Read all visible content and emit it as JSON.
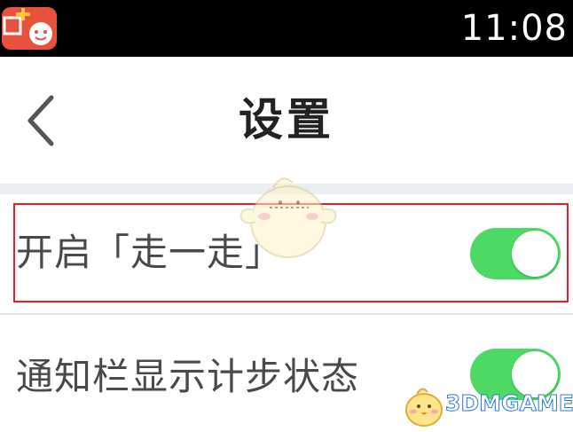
{
  "status_bar": {
    "time": "11:08",
    "notification_icon": "app-notification-icon"
  },
  "header": {
    "title": "设置",
    "back_icon": "chevron-left-icon"
  },
  "settings": [
    {
      "label": "开启「走一走」",
      "enabled": true
    },
    {
      "label": "通知栏显示计步状态",
      "enabled": true
    }
  ],
  "watermark": {
    "brand": "3DMGAME",
    "mascot_icon": "mascot-icon"
  },
  "colors": {
    "toggle_on": "#4cd964",
    "highlight": "#e0232b",
    "section_gap": "#e8eef1"
  }
}
